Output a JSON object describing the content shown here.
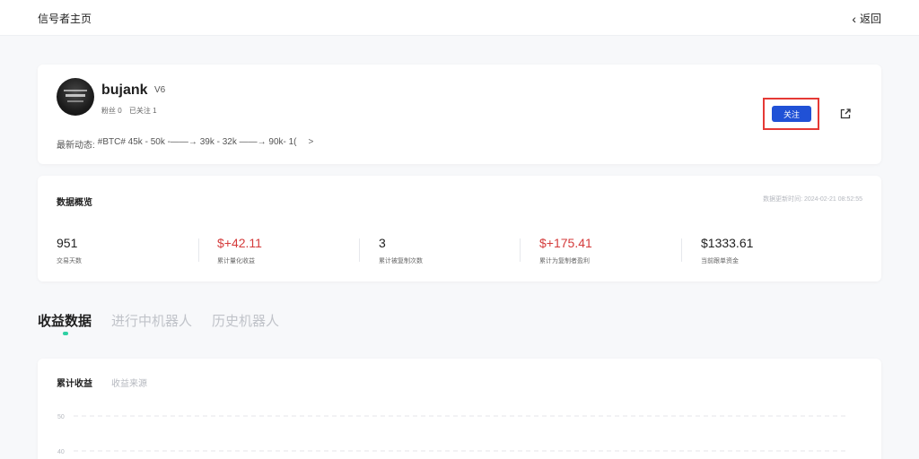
{
  "header": {
    "title": "信号者主页",
    "back_label": "返回"
  },
  "profile": {
    "name": "bujank",
    "name_tag": "V6",
    "fans_label": "粉丝 0",
    "following_label": "已关注 1",
    "latest_prefix": "最新动态:",
    "latest_text": "#BTC# 45k - 50k -——→ 39k - 32k ——→ 90k- 1(",
    "more_label": ">",
    "follow_label": "关注"
  },
  "overview": {
    "title": "数据概览",
    "update_time": "数据更新时间: 2024-02-21 08:52:55",
    "stats": [
      {
        "value": "951",
        "label": "交易天数"
      },
      {
        "value": "$+42.11",
        "label": "累计量化收益"
      },
      {
        "value": "3",
        "label": "累计被复制次数"
      },
      {
        "value": "$+175.41",
        "label": "累计为复制者盈利"
      },
      {
        "value": "$1333.61",
        "label": "当前跟单资金"
      }
    ]
  },
  "tabs": [
    {
      "label": "收益数据"
    },
    {
      "label": "进行中机器人"
    },
    {
      "label": "历史机器人"
    }
  ],
  "chart": {
    "subtabs": [
      {
        "label": "累计收益"
      },
      {
        "label": "收益来源"
      }
    ],
    "y_ticks": [
      "50",
      "40"
    ]
  },
  "colors": {
    "accent_blue": "#2051d6",
    "profit_red": "#d43b3b",
    "tab_indicator": "#2fd0a3",
    "highlight_border": "#e53935"
  },
  "icons": {
    "back": "chevron-left-icon",
    "share": "share-icon"
  }
}
